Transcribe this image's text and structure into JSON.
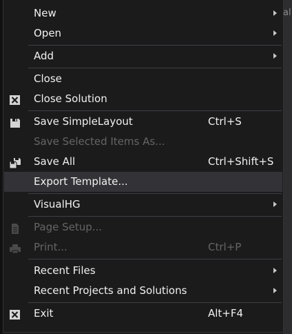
{
  "menu": {
    "new": {
      "label": "New"
    },
    "open": {
      "label": "Open"
    },
    "add": {
      "label": "Add"
    },
    "close": {
      "label": "Close"
    },
    "close_solution": {
      "label": "Close Solution",
      "icon": "close-x-icon"
    },
    "save": {
      "label": "Save SimpleLayout",
      "shortcut": "Ctrl+S",
      "icon": "save-disk-icon"
    },
    "save_selected": {
      "label": "Save Selected Items As..."
    },
    "save_all": {
      "label": "Save All",
      "shortcut": "Ctrl+Shift+S",
      "icon": "save-all-icon"
    },
    "export_template": {
      "label": "Export Template..."
    },
    "visualhg": {
      "label": "VisualHG"
    },
    "page_setup": {
      "label": "Page Setup...",
      "icon": "page-setup-icon"
    },
    "print": {
      "label": "Print...",
      "shortcut": "Ctrl+P",
      "icon": "printer-icon"
    },
    "recent_files": {
      "label": "Recent Files"
    },
    "recent_projects": {
      "label": "Recent Projects and Solutions"
    },
    "exit": {
      "label": "Exit",
      "shortcut": "Alt+F4",
      "icon": "exit-x-icon"
    }
  },
  "background": {
    "peek_text": "al"
  },
  "colors": {
    "menu_bg": "#1b1b1c",
    "text": "#f1f1f1",
    "disabled_text": "#656565",
    "highlight": "#333337",
    "separator": "#3f3f46"
  }
}
